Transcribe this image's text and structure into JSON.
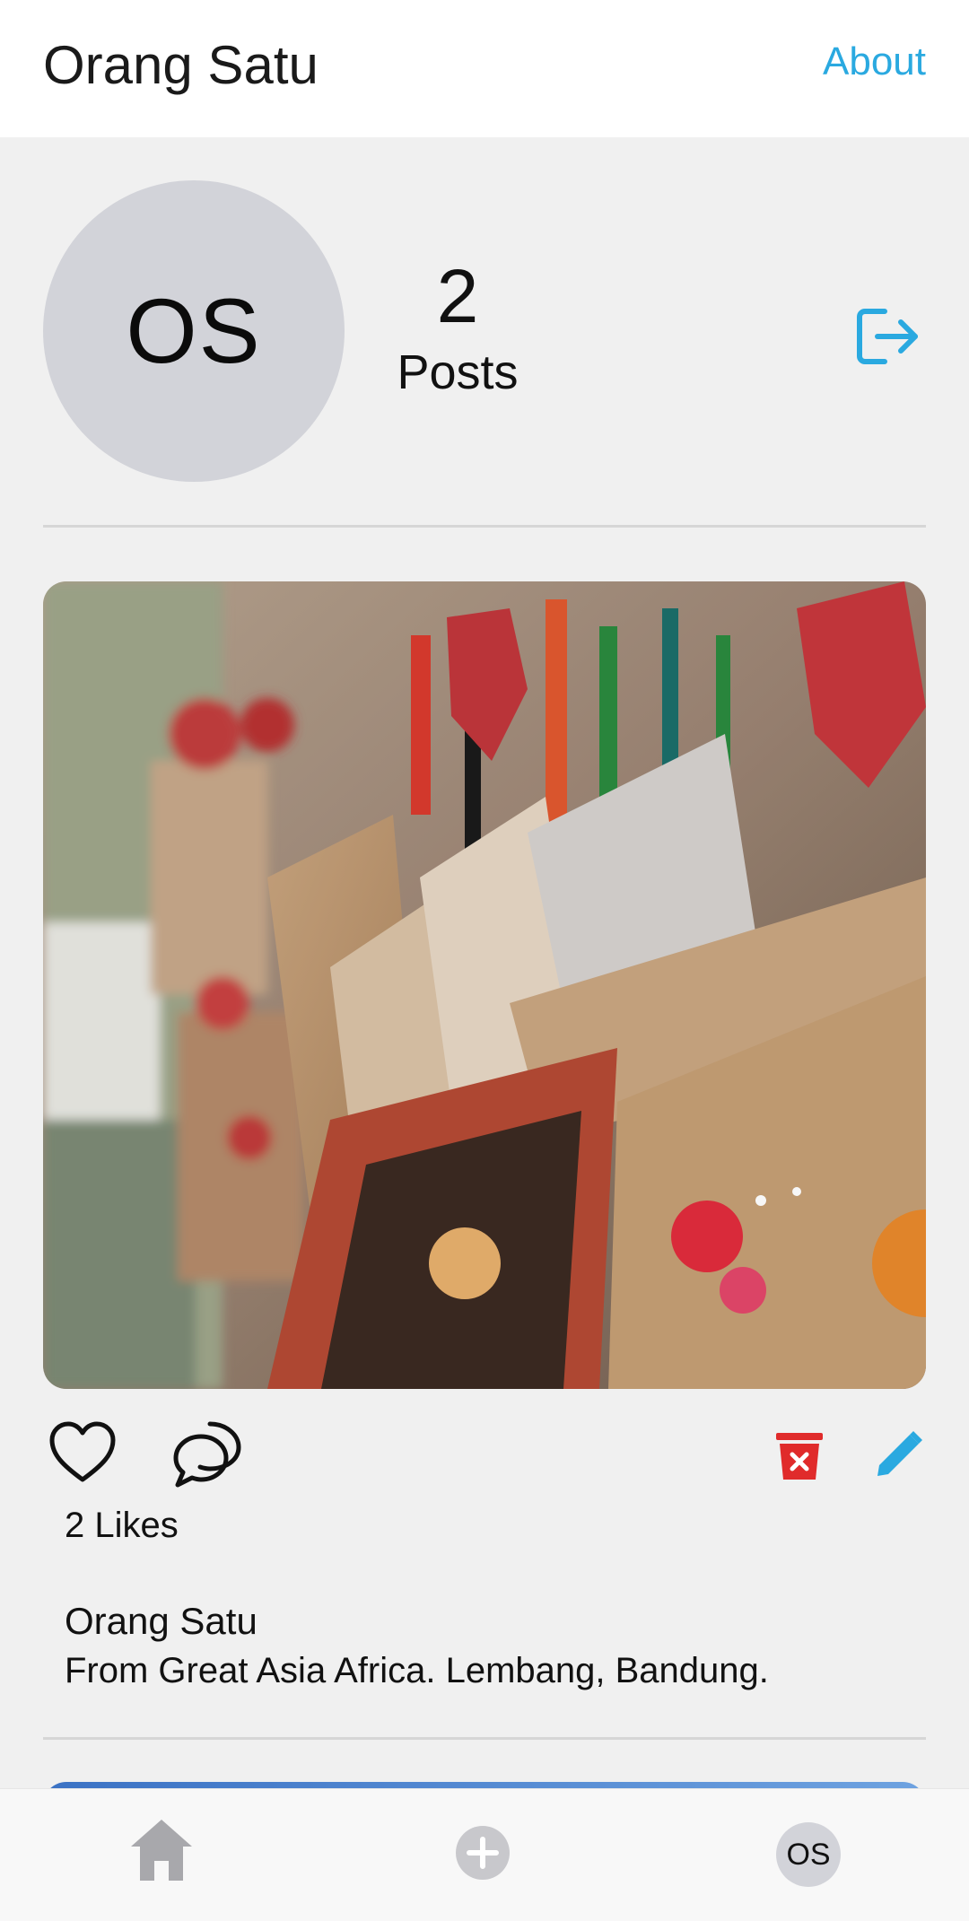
{
  "header": {
    "title": "Orang Satu",
    "about_label": "About"
  },
  "profile": {
    "avatar_initials": "OS",
    "posts_count": "2",
    "posts_label": "Posts",
    "logout_icon": "logout-icon"
  },
  "post": {
    "image_icon": "photo-ema-wooden-plaques",
    "like_icon": "heart-icon",
    "comment_icon": "comment-icon",
    "delete_icon": "trash-icon",
    "edit_icon": "pencil-icon",
    "likes_text": "2 Likes",
    "author": "Orang Satu",
    "caption": "From Great Asia Africa. Lembang, Bandung."
  },
  "bottom_nav": {
    "home_icon": "home-icon",
    "add_icon": "add-icon",
    "profile_initials": "OS"
  },
  "colors": {
    "accent": "#2aa9e0",
    "danger": "#e02b2b",
    "avatar_bg": "#d2d3d9"
  }
}
